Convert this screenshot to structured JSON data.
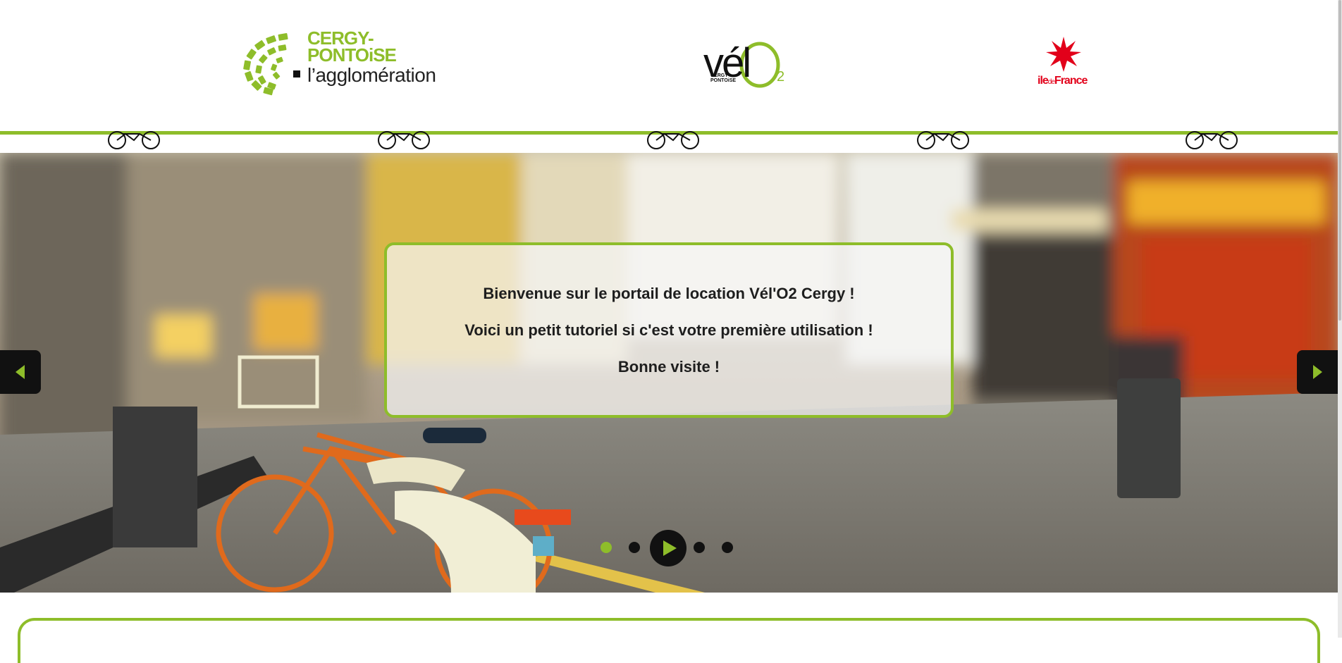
{
  "header": {
    "logo_cergy": {
      "line1": "CERGY-",
      "line2": "PONTOiSE",
      "line3": "l’agglomération"
    },
    "logo_velo": {
      "word": "vél",
      "sub_line1": "CERGY",
      "sub_line2": "PONTOiSE",
      "subscript": "2"
    },
    "logo_idf": {
      "part1": "ile",
      "part2": "de",
      "part3": "France"
    }
  },
  "slider": {
    "welcome_lines": [
      "Bienvenue sur le portail de location Vél'O2 Cergy !",
      "Voici un petit tutoriel si c'est votre première utilisation !",
      "Bonne visite !"
    ],
    "prev_icon": "arrow-left-icon",
    "next_icon": "arrow-right-icon",
    "play_icon": "play-icon",
    "dot_count": 5,
    "active_dot": 0
  },
  "colors": {
    "accent": "#8ebd2a",
    "idf_red": "#e2001a",
    "dark": "#111111"
  }
}
